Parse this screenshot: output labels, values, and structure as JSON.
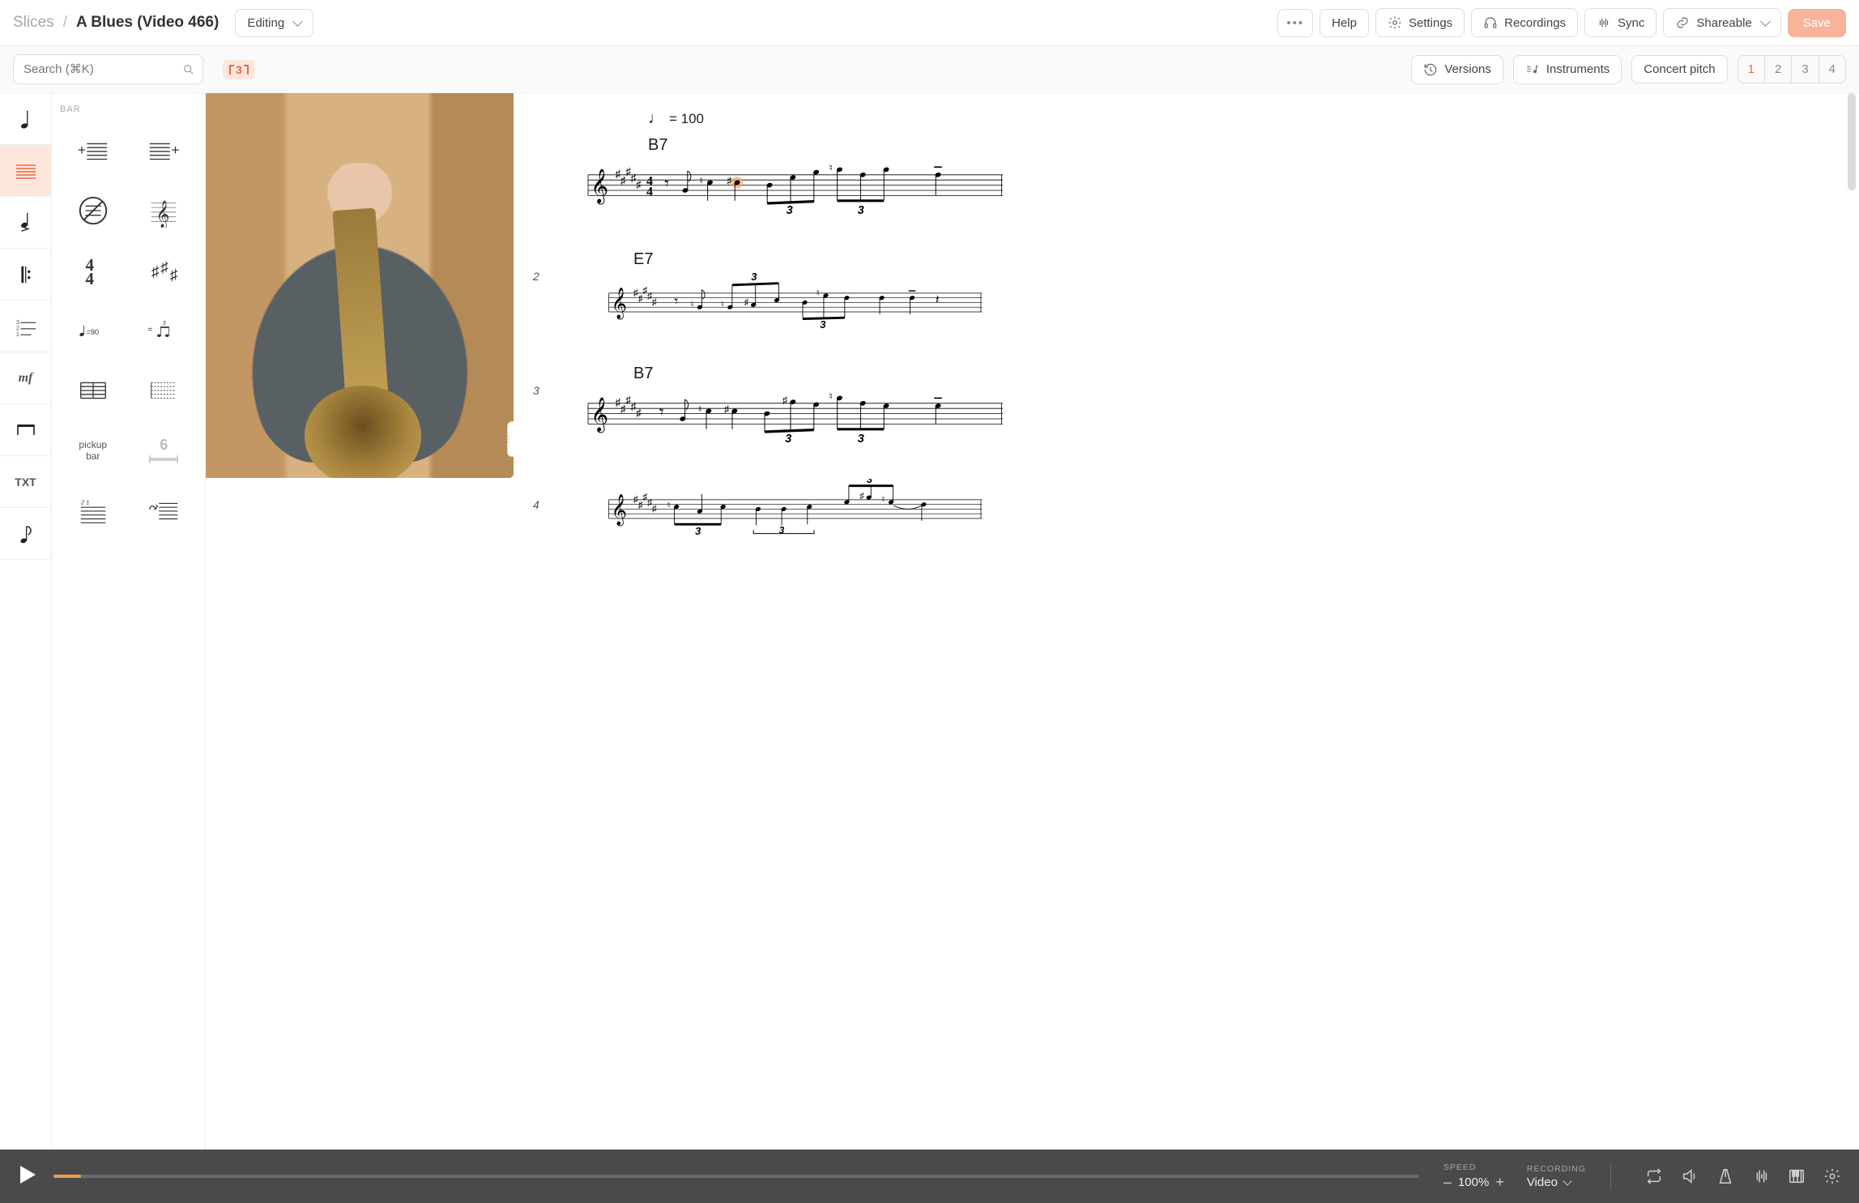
{
  "breadcrumb": {
    "root": "Slices",
    "title": "A Blues (Video 466)"
  },
  "mode_button": "Editing",
  "top": {
    "help": "Help",
    "settings": "Settings",
    "recordings": "Recordings",
    "sync": "Sync",
    "shareable": "Shareable",
    "save": "Save"
  },
  "search": {
    "placeholder": "Search (⌘K)"
  },
  "tuplet_badge": "3",
  "options": {
    "versions": "Versions",
    "instruments": "Instruments",
    "concert_pitch": "Concert pitch"
  },
  "pages": [
    "1",
    "2",
    "3",
    "4"
  ],
  "active_page_index": 0,
  "rail": {
    "note": "note",
    "staff": "staff",
    "accent": "accent",
    "repeat": "repeat",
    "tuplet_lines": "tuplet",
    "dynamics": "mf",
    "beam": "beam",
    "text": "TXT",
    "eighth": "eighth"
  },
  "panel": {
    "section": "BAR",
    "items": {
      "add_bar_before": "add-bar-before",
      "add_bar_after": "add-bar-after",
      "no_repeat": "no-repeat",
      "clef": "treble-clef",
      "time_sig": "4/4",
      "key_sig": "sharps",
      "tempo_label": "=90",
      "swing": "swing",
      "bar_count": "bar-lines",
      "staff_lines": "staff-lines",
      "pickup": "pickup\nbar",
      "multirest": "6",
      "rehearsal": "rehearsal-mark",
      "coda": "coda"
    }
  },
  "score": {
    "tempo": "= 100",
    "systems": [
      {
        "bar_number": "",
        "chord": "B7"
      },
      {
        "bar_number": "2",
        "chord": "E7"
      },
      {
        "bar_number": "3",
        "chord": "B7"
      },
      {
        "bar_number": "4",
        "chord": ""
      }
    ],
    "tuplet_text": "3"
  },
  "playbar": {
    "speed_label": "SPEED",
    "speed_value": "100%",
    "recording_label": "RECORDING",
    "recording_value": "Video"
  }
}
